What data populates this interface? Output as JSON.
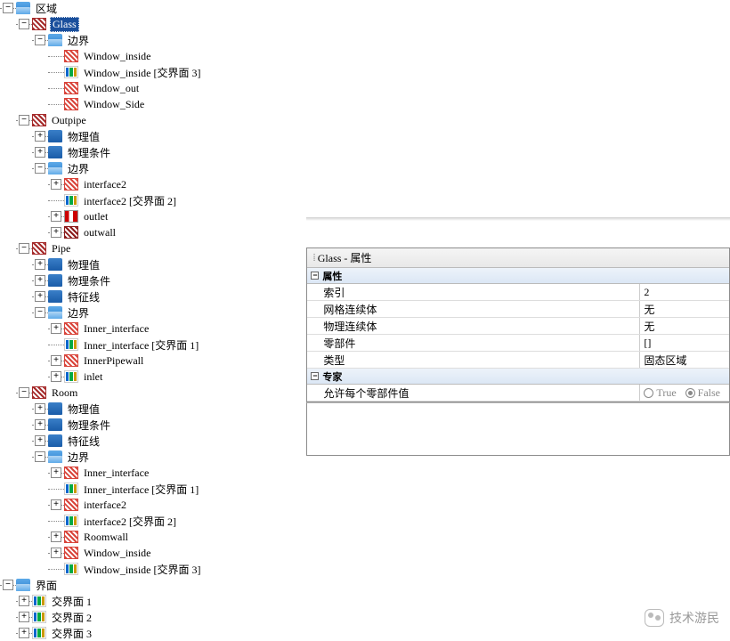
{
  "tree": {
    "region_root": "区域",
    "glass": "Glass",
    "boundary": "边界",
    "glass_children": [
      "Window_inside",
      "Window_inside [交界面 3]",
      "Window_out",
      "Window_Side"
    ],
    "outpipe": "Outpipe",
    "phys_value": "物理值",
    "phys_cond": "物理条件",
    "outpipe_boundary_children": [
      "interface2",
      "interface2 [交界面 2]",
      "outlet",
      "outwall"
    ],
    "pipe": "Pipe",
    "feature_line": "特征线",
    "pipe_boundary_children": [
      "Inner_interface",
      "Inner_interface [交界面 1]",
      "InnerPipewall",
      "inlet"
    ],
    "room": "Room",
    "room_boundary_children": [
      "Inner_interface",
      "Inner_interface [交界面 1]",
      "interface2",
      "interface2 [交界面 2]",
      "Roomwall",
      "Window_inside",
      "Window_inside [交界面 3]"
    ],
    "interfaces_root": "界面",
    "interfaces": [
      "交界面 1",
      "交界面 2",
      "交界面 3"
    ]
  },
  "panel": {
    "title": "Glass - 属性",
    "group1": "属性",
    "rows1": [
      {
        "k": "索引",
        "v": "2"
      },
      {
        "k": "网格连续体",
        "v": "无"
      },
      {
        "k": "物理连续体",
        "v": "无"
      },
      {
        "k": "零部件",
        "v": "[]"
      },
      {
        "k": "类型",
        "v": "固态区域"
      }
    ],
    "group2": "专家",
    "row2_key": "允许每个零部件值",
    "row2_true": "True",
    "row2_false": "False",
    "desc_title": ""
  },
  "watermark": "技术游民"
}
